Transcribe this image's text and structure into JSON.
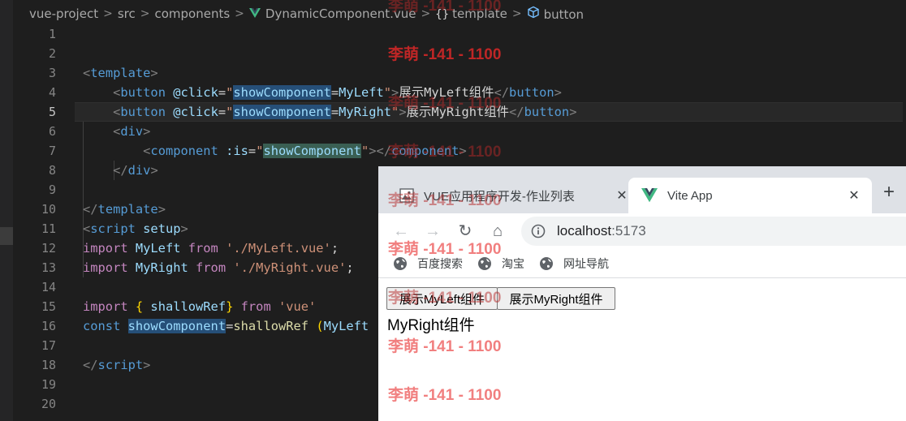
{
  "breadcrumb": {
    "items": [
      "vue-project",
      "src",
      "components",
      "DynamicComponent.vue",
      "template",
      "button"
    ],
    "separator": ">"
  },
  "editor": {
    "line_numbers": [
      "1",
      "2",
      "3",
      "4",
      "5",
      "6",
      "7",
      "8",
      "9",
      "10",
      "11",
      "12",
      "13",
      "14",
      "15",
      "16",
      "17",
      "18",
      "19",
      "20"
    ],
    "active_line": "5",
    "code": {
      "l3": {
        "open": "<",
        "tag": "template",
        "close": ">"
      },
      "l4": {
        "open": "<",
        "tag": "button",
        "attr": " @click",
        "eq": "=",
        "q1": "\"",
        "var": "showComponent",
        "eq2": "=",
        "val": "MyLeft",
        "q2": "\"",
        "gt": ">",
        "text": "展示MyLeft组件",
        "endopen": "</",
        "endtag": "button",
        "endclose": ">"
      },
      "l5": {
        "open": "<",
        "tag": "button",
        "attr": " @click",
        "eq": "=",
        "q1": "\"",
        "var": "showComponent",
        "eq2": "=",
        "val": "MyRight",
        "q2": "\"",
        "gt": ">",
        "text": "展示MyRight组件",
        "endopen": "</",
        "endtag": "button",
        "endclose": ">"
      },
      "l6": {
        "open": "<",
        "tag": "div",
        "close": ">"
      },
      "l7": {
        "open": "<",
        "tag": "component",
        "attr": " :is",
        "eq": "=",
        "q1": "\"",
        "var": "showComponent",
        "q2": "\"",
        "gt": ">",
        "endopen": "</",
        "endtag": "component",
        "endclose": ">"
      },
      "l8": {
        "open": "</",
        "tag": "div",
        "close": ">"
      },
      "l10": {
        "open": "</",
        "tag": "template",
        "close": ">"
      },
      "l11": {
        "open": "<",
        "tag": "script",
        "attr": " setup",
        "close": ">"
      },
      "l12": {
        "kw": "import",
        "name": " MyLeft ",
        "from": "from",
        "str": " './MyLeft.vue'",
        "semi": ";"
      },
      "l13": {
        "kw": "import",
        "name": " MyRight ",
        "from": "from",
        "str": " './MyRight.vue'",
        "semi": ";"
      },
      "l15": {
        "kw": "import",
        "brace1": " {",
        "name": " shallowRef",
        "brace2": "}",
        "from": " from",
        "str": " 'vue'"
      },
      "l16": {
        "kw": "const",
        "var": "showComponent",
        "eq": "=",
        "func": "shallowRef",
        "paren": " (",
        "arg": "MyLeft"
      },
      "l18": {
        "open": "</",
        "tag": "script",
        "close": ">"
      }
    }
  },
  "browser": {
    "tabs": [
      {
        "title": "VUE应用程序开发-作业列表",
        "close": "✕"
      },
      {
        "title": "Vite App",
        "close": "✕"
      }
    ],
    "new_tab": "+",
    "nav": {
      "back": "←",
      "forward": "→",
      "reload": "↻",
      "home": "⌂"
    },
    "url": {
      "host": "localhost",
      "port": ":5173"
    },
    "bookmarks": [
      "百度搜索",
      "淘宝",
      "网址导航"
    ],
    "page": {
      "button_left": "展示MyLeft组件",
      "button_right": "展示MyRight组件",
      "component_text": "MyRight组件"
    }
  },
  "watermark": "李萌 -141 - 1100"
}
